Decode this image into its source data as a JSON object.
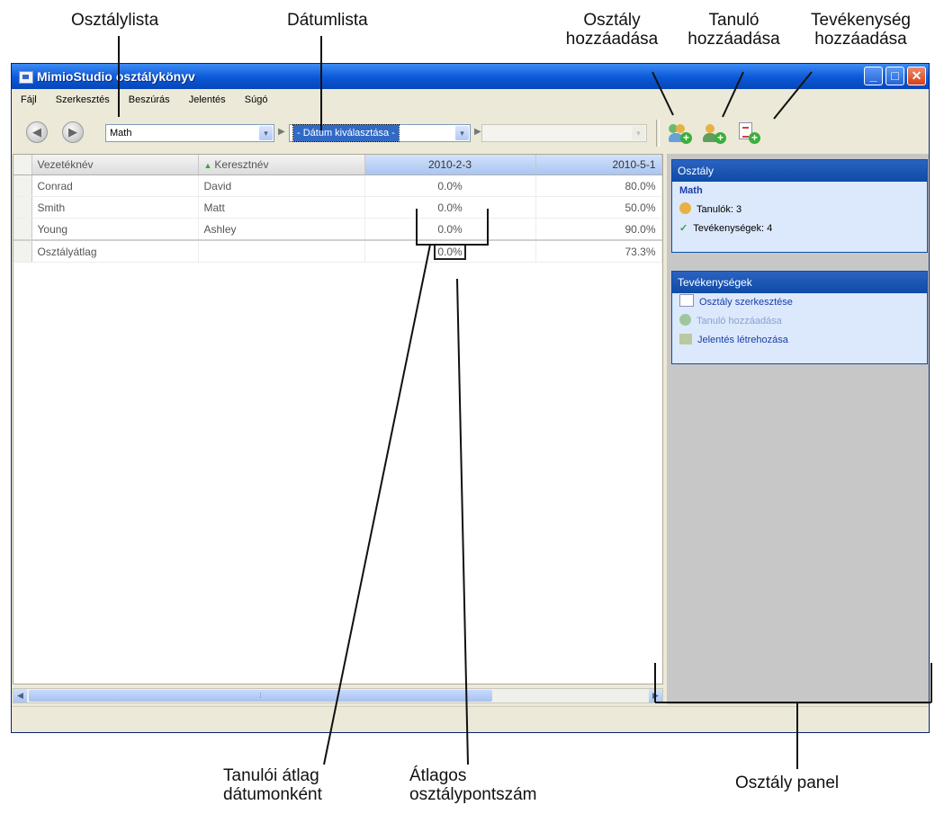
{
  "callouts": {
    "class_list": "Osztálylista",
    "date_list": "Dátumlista",
    "add_class": [
      "Osztály",
      "hozzáadása"
    ],
    "add_student": [
      "Tanuló",
      "hozzáadása"
    ],
    "add_activity": [
      "Tevékenység",
      "hozzáadása"
    ],
    "student_avg": [
      "Tanulói átlag",
      "dátumonként"
    ],
    "class_avg": [
      "Átlagos",
      "osztálypontszám"
    ],
    "class_panel": "Osztály panel"
  },
  "window": {
    "title": "MimioStudio osztálykönyv",
    "controls": {
      "minimize": "_",
      "maximize": "□",
      "close": "✕"
    }
  },
  "menu": [
    "Fájl",
    "Szerkesztés",
    "Beszúrás",
    "Jelentés",
    "Súgó"
  ],
  "toolbar": {
    "back_icon": "back-arrow-icon",
    "forward_icon": "forward-arrow-icon",
    "class_value": "Math",
    "date_value": "- Dátum kiválasztása -",
    "activity_value": "",
    "sep": "▶",
    "dropdown_arrow": "▾"
  },
  "grid": {
    "columns": [
      "Vezetéknév",
      "Keresztnév",
      "2010-2-3",
      "2010-5-1"
    ],
    "sort_indicator": "▲",
    "rows": [
      [
        "Conrad",
        "David",
        "0.0%",
        "80.0%"
      ],
      [
        "Smith",
        "Matt",
        "0.0%",
        "50.0%"
      ],
      [
        "Young",
        "Ashley",
        "0.0%",
        "90.0%"
      ]
    ],
    "average_row": [
      "Osztályátlag",
      "",
      "0.0%",
      "73.3%"
    ]
  },
  "scroll": {
    "left": "◀",
    "right": "▶",
    "thumb": "⁞"
  },
  "panel": {
    "class_header": "Osztály",
    "class_name": "Math",
    "students": "Tanulók: 3",
    "activities": "Tevékenységek: 4",
    "actions_header": "Tevékenységek",
    "actions": [
      "Osztály szerkesztése",
      "Tanuló hozzáadása",
      "Jelentés létrehozása"
    ]
  },
  "colors": {
    "title_bar": "#0a58d6",
    "panel_header": "#0e4ba7",
    "panel_bg": "#dce9fc",
    "selected": "#316ac5"
  }
}
